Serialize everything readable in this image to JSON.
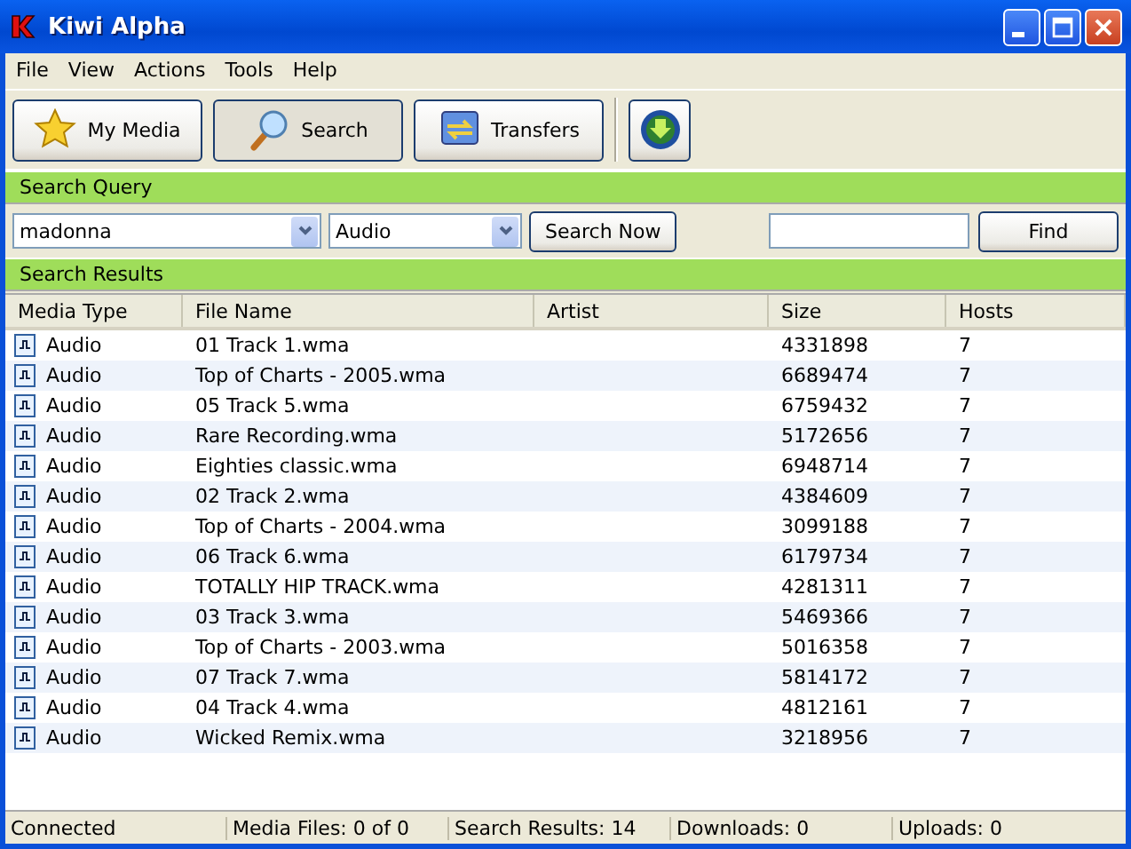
{
  "window": {
    "title": "Kiwi Alpha"
  },
  "menu": [
    "File",
    "View",
    "Actions",
    "Tools",
    "Help"
  ],
  "toolbar": [
    {
      "label": "My Media",
      "kind": "star",
      "selected": false
    },
    {
      "label": "Search",
      "kind": "magnifier",
      "selected": true
    },
    {
      "label": "Transfers",
      "kind": "transfer",
      "selected": false
    }
  ],
  "search_query": {
    "title": "Search Query",
    "query": "madonna",
    "media_type": "Audio",
    "search_button": "Search Now",
    "find_button": "Find"
  },
  "search_results": {
    "title": "Search Results",
    "columns": [
      "Media Type",
      "File Name",
      "Artist",
      "Size",
      "Hosts"
    ],
    "rows": [
      {
        "type": "Audio",
        "file": "01 Track 1.wma",
        "size": "4331898",
        "hosts": "7"
      },
      {
        "type": "Audio",
        "file": "Top of Charts - 2005.wma",
        "size": "6689474",
        "hosts": "7"
      },
      {
        "type": "Audio",
        "file": "05 Track 5.wma",
        "size": "6759432",
        "hosts": "7"
      },
      {
        "type": "Audio",
        "file": "Rare Recording.wma",
        "size": "5172656",
        "hosts": "7"
      },
      {
        "type": "Audio",
        "file": "Eighties classic.wma",
        "size": "6948714",
        "hosts": "7"
      },
      {
        "type": "Audio",
        "file": "02 Track 2.wma",
        "size": "4384609",
        "hosts": "7"
      },
      {
        "type": "Audio",
        "file": "Top of Charts - 2004.wma",
        "size": "3099188",
        "hosts": "7"
      },
      {
        "type": "Audio",
        "file": "06 Track 6.wma",
        "size": "6179734",
        "hosts": "7"
      },
      {
        "type": "Audio",
        "file": "TOTALLY HIP TRACK.wma",
        "size": "4281311",
        "hosts": "7"
      },
      {
        "type": "Audio",
        "file": "03 Track 3.wma",
        "size": "5469366",
        "hosts": "7"
      },
      {
        "type": "Audio",
        "file": "Top of Charts - 2003.wma",
        "size": "5016358",
        "hosts": "7"
      },
      {
        "type": "Audio",
        "file": "07 Track 7.wma",
        "size": "5814172",
        "hosts": "7"
      },
      {
        "type": "Audio",
        "file": "04 Track 4.wma",
        "size": "4812161",
        "hosts": "7"
      },
      {
        "type": "Audio",
        "file": "Wicked Remix.wma",
        "size": "3218956",
        "hosts": "7"
      }
    ]
  },
  "status_bar": [
    "Connected",
    "Media Files: 0 of 0",
    "Search Results: 14",
    "Downloads: 0",
    "Uploads: 0"
  ]
}
